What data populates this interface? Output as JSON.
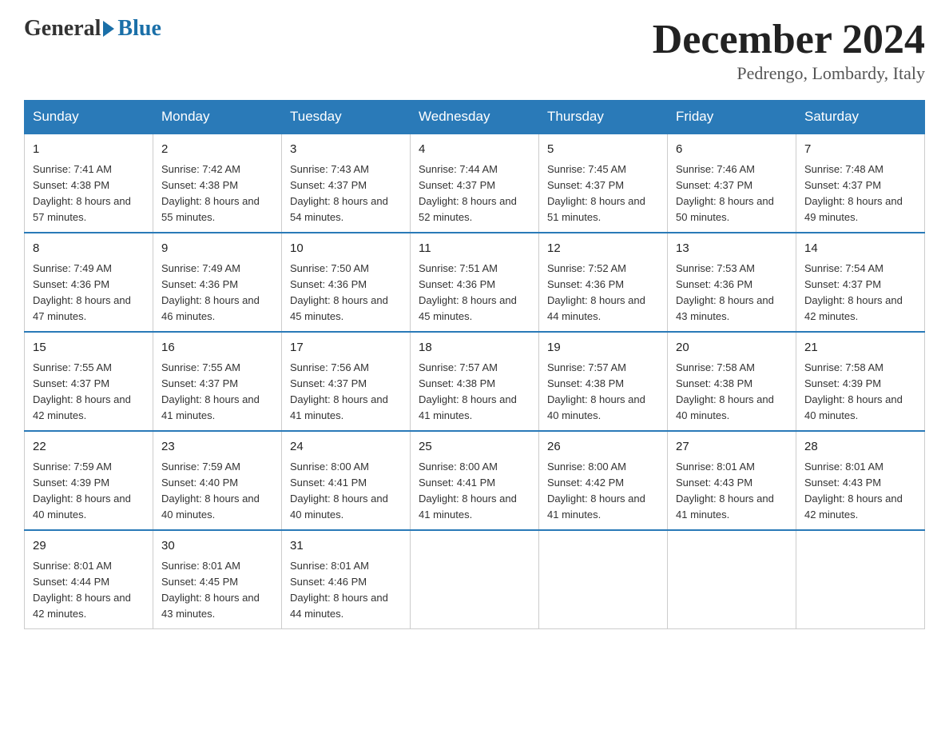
{
  "header": {
    "logo": {
      "general": "General",
      "blue": "Blue"
    },
    "title": "December 2024",
    "location": "Pedrengo, Lombardy, Italy"
  },
  "columns": [
    "Sunday",
    "Monday",
    "Tuesday",
    "Wednesday",
    "Thursday",
    "Friday",
    "Saturday"
  ],
  "weeks": [
    [
      {
        "day": "1",
        "sunrise": "7:41 AM",
        "sunset": "4:38 PM",
        "daylight": "8 hours and 57 minutes."
      },
      {
        "day": "2",
        "sunrise": "7:42 AM",
        "sunset": "4:38 PM",
        "daylight": "8 hours and 55 minutes."
      },
      {
        "day": "3",
        "sunrise": "7:43 AM",
        "sunset": "4:37 PM",
        "daylight": "8 hours and 54 minutes."
      },
      {
        "day": "4",
        "sunrise": "7:44 AM",
        "sunset": "4:37 PM",
        "daylight": "8 hours and 52 minutes."
      },
      {
        "day": "5",
        "sunrise": "7:45 AM",
        "sunset": "4:37 PM",
        "daylight": "8 hours and 51 minutes."
      },
      {
        "day": "6",
        "sunrise": "7:46 AM",
        "sunset": "4:37 PM",
        "daylight": "8 hours and 50 minutes."
      },
      {
        "day": "7",
        "sunrise": "7:48 AM",
        "sunset": "4:37 PM",
        "daylight": "8 hours and 49 minutes."
      }
    ],
    [
      {
        "day": "8",
        "sunrise": "7:49 AM",
        "sunset": "4:36 PM",
        "daylight": "8 hours and 47 minutes."
      },
      {
        "day": "9",
        "sunrise": "7:49 AM",
        "sunset": "4:36 PM",
        "daylight": "8 hours and 46 minutes."
      },
      {
        "day": "10",
        "sunrise": "7:50 AM",
        "sunset": "4:36 PM",
        "daylight": "8 hours and 45 minutes."
      },
      {
        "day": "11",
        "sunrise": "7:51 AM",
        "sunset": "4:36 PM",
        "daylight": "8 hours and 45 minutes."
      },
      {
        "day": "12",
        "sunrise": "7:52 AM",
        "sunset": "4:36 PM",
        "daylight": "8 hours and 44 minutes."
      },
      {
        "day": "13",
        "sunrise": "7:53 AM",
        "sunset": "4:36 PM",
        "daylight": "8 hours and 43 minutes."
      },
      {
        "day": "14",
        "sunrise": "7:54 AM",
        "sunset": "4:37 PM",
        "daylight": "8 hours and 42 minutes."
      }
    ],
    [
      {
        "day": "15",
        "sunrise": "7:55 AM",
        "sunset": "4:37 PM",
        "daylight": "8 hours and 42 minutes."
      },
      {
        "day": "16",
        "sunrise": "7:55 AM",
        "sunset": "4:37 PM",
        "daylight": "8 hours and 41 minutes."
      },
      {
        "day": "17",
        "sunrise": "7:56 AM",
        "sunset": "4:37 PM",
        "daylight": "8 hours and 41 minutes."
      },
      {
        "day": "18",
        "sunrise": "7:57 AM",
        "sunset": "4:38 PM",
        "daylight": "8 hours and 41 minutes."
      },
      {
        "day": "19",
        "sunrise": "7:57 AM",
        "sunset": "4:38 PM",
        "daylight": "8 hours and 40 minutes."
      },
      {
        "day": "20",
        "sunrise": "7:58 AM",
        "sunset": "4:38 PM",
        "daylight": "8 hours and 40 minutes."
      },
      {
        "day": "21",
        "sunrise": "7:58 AM",
        "sunset": "4:39 PM",
        "daylight": "8 hours and 40 minutes."
      }
    ],
    [
      {
        "day": "22",
        "sunrise": "7:59 AM",
        "sunset": "4:39 PM",
        "daylight": "8 hours and 40 minutes."
      },
      {
        "day": "23",
        "sunrise": "7:59 AM",
        "sunset": "4:40 PM",
        "daylight": "8 hours and 40 minutes."
      },
      {
        "day": "24",
        "sunrise": "8:00 AM",
        "sunset": "4:41 PM",
        "daylight": "8 hours and 40 minutes."
      },
      {
        "day": "25",
        "sunrise": "8:00 AM",
        "sunset": "4:41 PM",
        "daylight": "8 hours and 41 minutes."
      },
      {
        "day": "26",
        "sunrise": "8:00 AM",
        "sunset": "4:42 PM",
        "daylight": "8 hours and 41 minutes."
      },
      {
        "day": "27",
        "sunrise": "8:01 AM",
        "sunset": "4:43 PM",
        "daylight": "8 hours and 41 minutes."
      },
      {
        "day": "28",
        "sunrise": "8:01 AM",
        "sunset": "4:43 PM",
        "daylight": "8 hours and 42 minutes."
      }
    ],
    [
      {
        "day": "29",
        "sunrise": "8:01 AM",
        "sunset": "4:44 PM",
        "daylight": "8 hours and 42 minutes."
      },
      {
        "day": "30",
        "sunrise": "8:01 AM",
        "sunset": "4:45 PM",
        "daylight": "8 hours and 43 minutes."
      },
      {
        "day": "31",
        "sunrise": "8:01 AM",
        "sunset": "4:46 PM",
        "daylight": "8 hours and 44 minutes."
      },
      null,
      null,
      null,
      null
    ]
  ]
}
